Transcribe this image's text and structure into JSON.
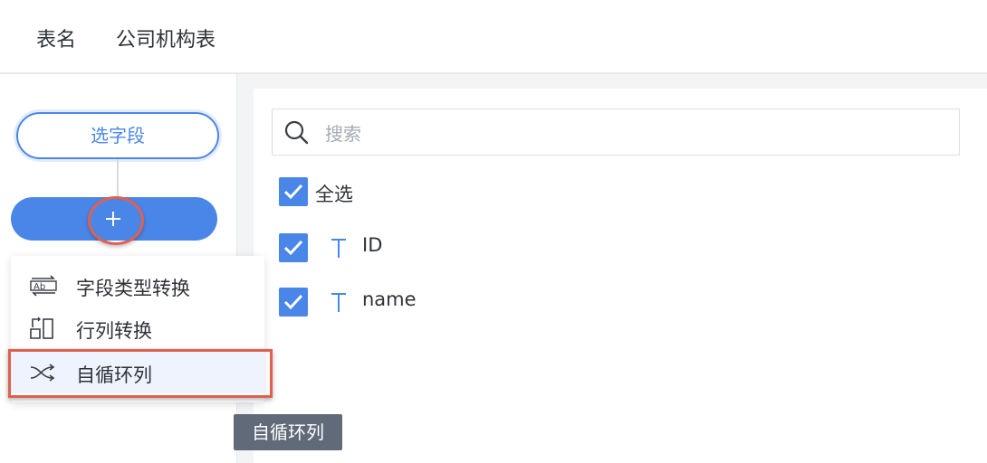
{
  "header": {
    "table_label": "表名",
    "table_name": "公司机构表"
  },
  "flow": {
    "step_label": "选字段",
    "add_symbol": "+"
  },
  "menu": {
    "items": [
      {
        "label": "字段类型转换",
        "icon": "field-type-convert-icon"
      },
      {
        "label": "行列转换",
        "icon": "row-column-convert-icon"
      },
      {
        "label": "自循环列",
        "icon": "shuffle-icon",
        "selected": true
      }
    ]
  },
  "tooltip": {
    "text": "自循环列"
  },
  "search": {
    "placeholder": "搜索"
  },
  "fields": {
    "select_all_label": "全选",
    "items": [
      {
        "name": "ID",
        "type_icon": "text-type-icon",
        "checked": true
      },
      {
        "name": "name",
        "type_icon": "text-type-icon",
        "checked": true
      }
    ]
  },
  "colors": {
    "primary": "#4a86e8",
    "highlight": "#e0604f",
    "tooltip_bg": "#606a78"
  }
}
